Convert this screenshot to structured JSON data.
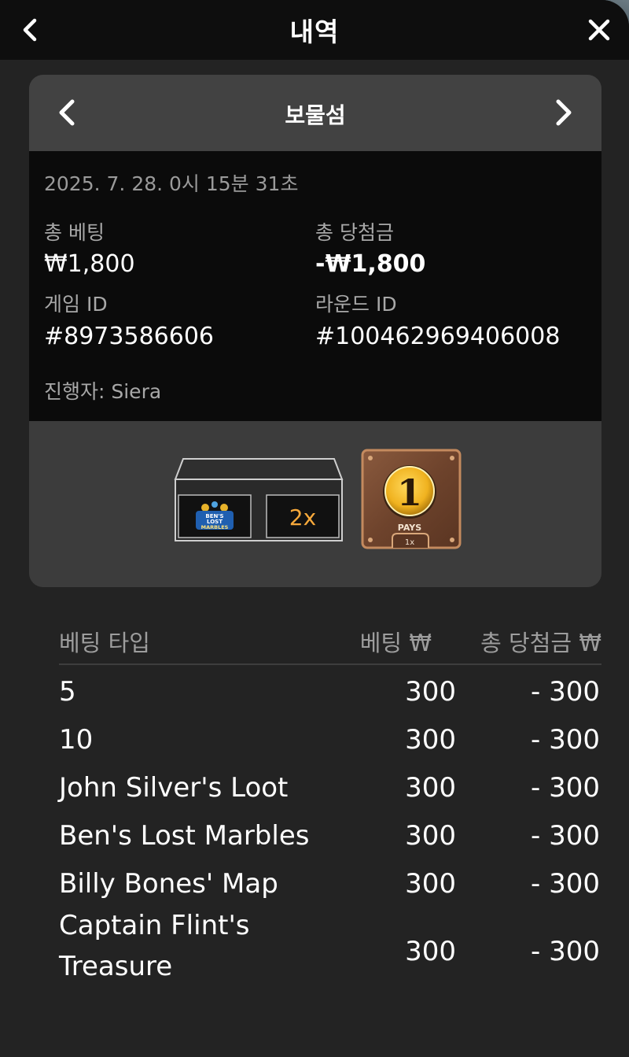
{
  "header": {
    "title": "내역"
  },
  "card": {
    "title": "보물섬",
    "datetime": "2025. 7. 28. 0시 15분 31초",
    "total_bet_label": "총 베팅",
    "total_bet_value": "₩1,800",
    "total_win_label": "총 당첨금",
    "total_win_value": "-₩1,800",
    "game_id_label": "게임 ID",
    "game_id_value": "#8973586606",
    "round_id_label": "라운드 ID",
    "round_id_value": "#100462969406008",
    "dealer": "진행자: Siera"
  },
  "result": {
    "slot1_label": "BEN'S LOST MARBLES",
    "slot2_label": "2x",
    "coin_number": "1",
    "coin_caption": "PAYS",
    "coin_multiplier": "1x"
  },
  "table": {
    "col_type": "베팅 타입",
    "col_bet": "베팅 ₩",
    "col_win": "총 당첨금 ₩",
    "rows": [
      {
        "type": "5",
        "bet": "300",
        "win": "- 300"
      },
      {
        "type": "10",
        "bet": "300",
        "win": "- 300"
      },
      {
        "type": "John Silver's Loot",
        "bet": "300",
        "win": "- 300"
      },
      {
        "type": "Ben's Lost Marbles",
        "bet": "300",
        "win": "- 300"
      },
      {
        "type": "Billy Bones' Map",
        "bet": "300",
        "win": "- 300"
      },
      {
        "type": "Captain Flint's Treasure",
        "bet": "300",
        "win": "- 300"
      }
    ]
  },
  "icons": {
    "back": "chevron-left-icon",
    "close": "close-icon",
    "prev": "chevron-left-icon",
    "next": "chevron-right-icon"
  },
  "colors": {
    "background": "#232323",
    "topbar": "#0e0e0e",
    "card_header": "#424242",
    "info_panel": "#0b0b0b",
    "muted_text": "#9a9a9a",
    "coin_gold": "#f0b21f"
  }
}
